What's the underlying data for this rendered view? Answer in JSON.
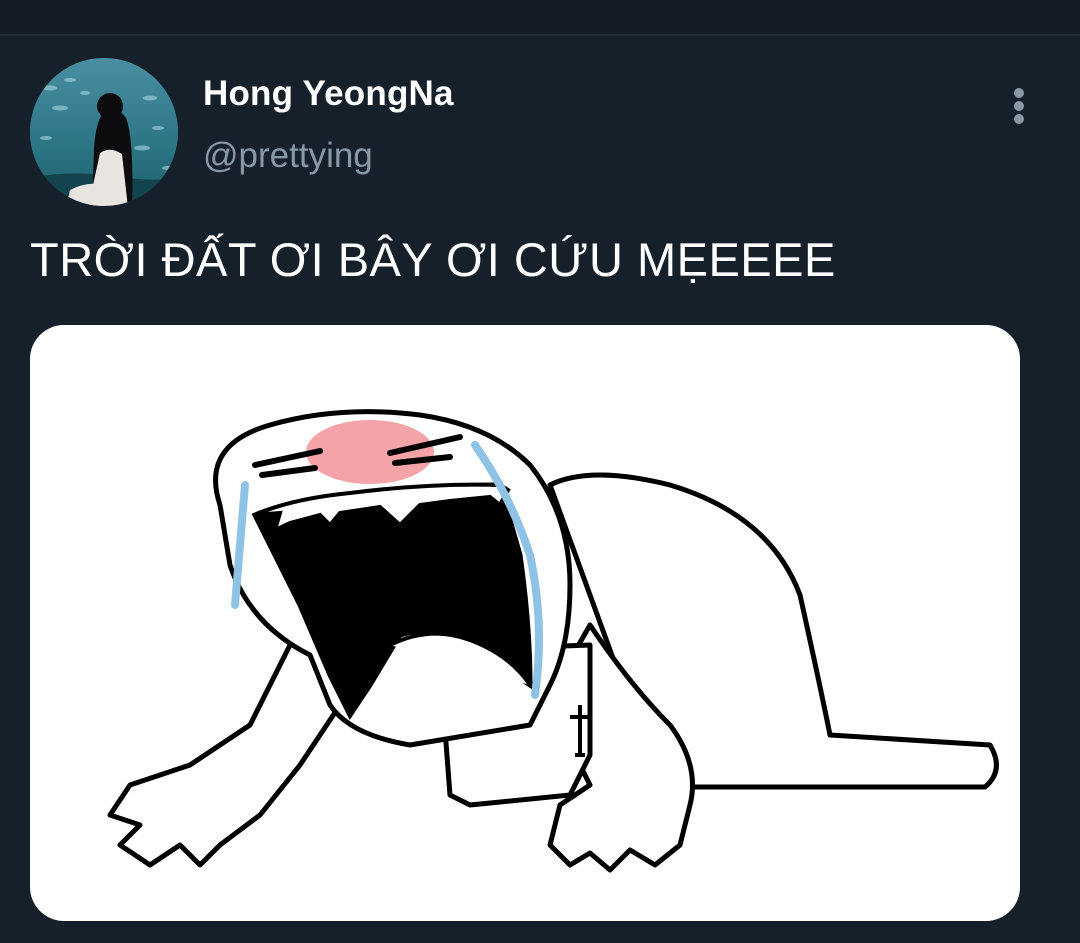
{
  "user": {
    "display_name": "Hong YeongNa",
    "handle": "@prettying",
    "avatar_icon": "profile-avatar"
  },
  "tweet": {
    "text": "TRỜI ĐẤT ƠI BÂY ƠI CỨU MẸEEEE"
  },
  "menu": {
    "icon": "more-vertical-icon"
  },
  "media": {
    "icon": "crying-meme-drawing"
  },
  "colors": {
    "background": "#15202b",
    "name": "#ffffff",
    "handle": "#8899a6",
    "tears": "#8fc3e6",
    "blush": "#f4a3a8"
  }
}
